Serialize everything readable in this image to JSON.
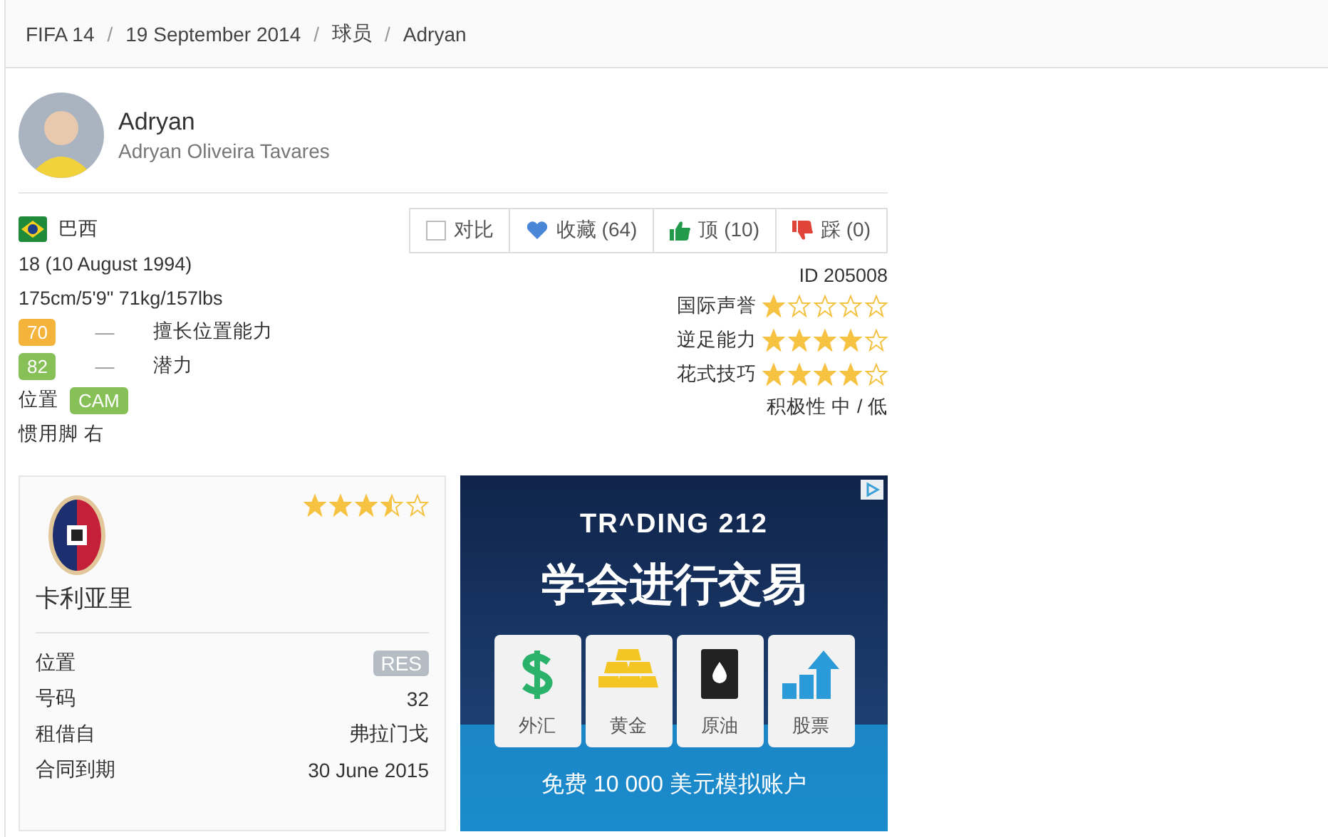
{
  "breadcrumb": {
    "separator": "/",
    "items": [
      "FIFA 14",
      "19 September 2014",
      "球员",
      "Adryan"
    ]
  },
  "player": {
    "name": "Adryan",
    "full_name": "Adryan Oliveira Tavares"
  },
  "info": {
    "nationality": "巴西",
    "age": "18 (10 August 1994)",
    "body": "175cm/5'9\" 71kg/157lbs"
  },
  "ratings": [
    {
      "value": "70",
      "dash": "—",
      "label": "擅长位置能力",
      "color": "#f4b43c"
    },
    {
      "value": "82",
      "dash": "—",
      "label": "潜力",
      "color": "#86c057"
    }
  ],
  "position": {
    "label": "位置",
    "value": "CAM"
  },
  "foot": "惯用脚 右",
  "actions": [
    {
      "kind": "checkbox",
      "label": "对比",
      "checked": false
    },
    {
      "kind": "heart",
      "label": "收藏 (64)"
    },
    {
      "kind": "thumbs-up",
      "label": "顶 (10)"
    },
    {
      "kind": "thumbs-down",
      "label": "踩 (0)"
    }
  ],
  "player_id": "ID 205008",
  "skills": [
    {
      "label": "国际声誉",
      "stars": 1
    },
    {
      "label": "逆足能力",
      "stars": 4
    },
    {
      "label": "花式技巧",
      "stars": 4
    }
  ],
  "work_rate": "积极性 中 / 低",
  "club": {
    "name": "卡利亚里",
    "stars": 3.5,
    "details": [
      {
        "label": "位置",
        "value": "RES",
        "kind": "badge"
      },
      {
        "label": "号码",
        "value": "32",
        "kind": "text"
      },
      {
        "label": "租借自",
        "value": "弗拉门戈",
        "kind": "text"
      },
      {
        "label": "合同到期",
        "value": "30 June 2015",
        "kind": "text"
      }
    ]
  },
  "ad": {
    "brand": "TR^DING 212",
    "headline": "学会进行交易",
    "tiles": [
      {
        "kind": "dollar",
        "label": "外汇"
      },
      {
        "kind": "gold",
        "label": "黄金"
      },
      {
        "kind": "oil",
        "label": "原油"
      },
      {
        "kind": "stocks",
        "label": "股票"
      }
    ],
    "footer": "免费 10 000 美元模拟账户"
  }
}
